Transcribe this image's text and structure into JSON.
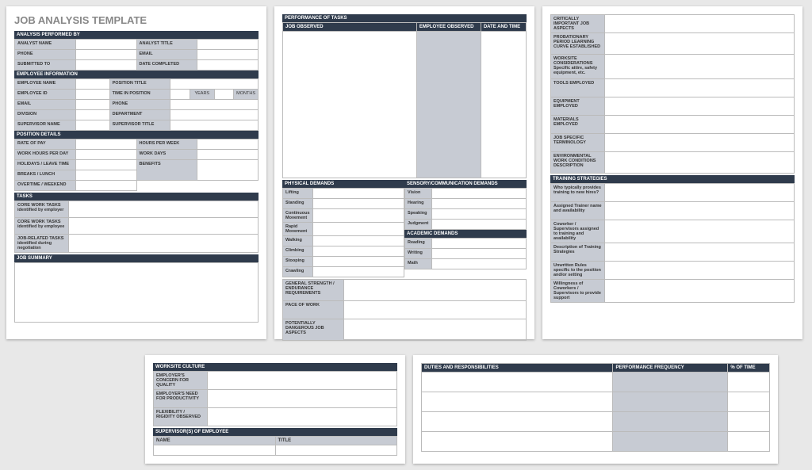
{
  "title": "JOB ANALYSIS TEMPLATE",
  "sections": {
    "analysis_performed_by": "ANALYSIS PERFORMED BY",
    "employee_information": "EMPLOYEE INFORMATION",
    "position_details": "POSITION DETAILS",
    "tasks": "TASKS",
    "job_summary": "JOB SUMMARY",
    "performance_of_tasks": "PERFORMANCE OF TASKS",
    "physical_demands": "PHYSICAL DEMANDS",
    "sensory_communication_demands": "SENSORY/COMMUNICATION DEMANDS",
    "academic_demands": "ACADEMIC DEMANDS",
    "training_strategies": "TRAINING STRATEGIES",
    "worksite_culture": "WORKSITE CULTURE",
    "supervisors_of_employee": "SUPERVISOR(S) OF EMPLOYEE",
    "duties_and_responsibilities": "DUTIES AND RESPONSIBILITIES"
  },
  "fields": {
    "analyst_name": "ANALYST NAME",
    "analyst_title": "ANALYST TITLE",
    "phone": "PHONE",
    "email": "EMAIL",
    "submitted_to": "SUBMITTED TO",
    "date_completed": "DATE COMPLETED",
    "employee_name": "EMPLOYEE NAME",
    "position_title": "POSITION TITLE",
    "employee_id": "EMPLOYEE ID",
    "time_in_position": "TIME IN POSITION",
    "years": "YEARS",
    "months": "MONTHS",
    "division": "DIVISION",
    "department": "DEPARTMENT",
    "supervisor_name": "SUPERVISOR NAME",
    "supervisor_title": "SUPERVISOR TITLE",
    "rate_of_pay": "RATE OF PAY",
    "hours_per_week": "HOURS PER WEEK",
    "work_hours_per_day": "WORK HOURS PER DAY",
    "work_days": "WORK DAYS",
    "holidays_leave_time": "HOLIDAYS / LEAVE TIME",
    "breaks_lunch": "BREAKS / LUNCH",
    "benefits": "BENEFITS",
    "overtime_weekend": "OVERTIME / WEEKEND",
    "core_work_tasks_employer": "CORE WORK TASKS identified by employer",
    "core_work_tasks_employee": "CORE WORK TASKS identified by employee",
    "job_related_tasks_neg": "JOB-RELATED TASKS identified during negotiation",
    "job_observed": "JOB OBSERVED",
    "employee_observed": "EMPLOYEE OBSERVED",
    "date_and_time": "DATE AND TIME",
    "lifting": "Lifting",
    "standing": "Standing",
    "continuous_movement": "Continuous Movement",
    "rapid_movement": "Rapid Movement",
    "walking": "Walking",
    "climbing": "Climbing",
    "stooping": "Stooping",
    "crawling": "Crawling",
    "vision": "Vision",
    "hearing": "Hearing",
    "speaking": "Speaking",
    "judgment": "Judgment",
    "reading": "Reading",
    "writing": "Writing",
    "math": "Math",
    "general_strength": "GENERAL STRENGTH / ENDURANCE REQUIREMENTS",
    "pace_of_work": "PACE OF WORK",
    "potentially_dangerous": "POTENTIALLY DANGEROUS JOB ASPECTS",
    "critically_important": "CRITICALLY IMPORTANT JOB ASPECTS",
    "probationary_period": "PROBATIONARY PERIOD LEARNING CURVE ESTABLISHED",
    "worksite_considerations": "WORKSITE CONSIDERATIONS Specific attire, safety equipment, etc.",
    "tools_employed": "TOOLS EMPLOYED",
    "equipment_employed": "EQUIPMENT EMPLOYED",
    "materials_employed": "MATERIALS EMPLOYED",
    "job_specific_terminology": "JOB SPECIFIC TERMINOLOGY",
    "environmental_work": "ENVIRONMENTAL WORK CONDITIONS DESCRIPTION",
    "who_typically_provides": "Who typically provides training to new hires?",
    "assigned_trainer": "Assigned Trainer name and availability",
    "coworker_supervisors": "Coworker / Supervisors assigned to training and availability",
    "description_training": "Description of Training Strategies",
    "unwritten_rules": "Unwritten Rules specific to the position and/or setting",
    "willingness_coworkers": "Willingness of Coworkers / Supervisors to provide support",
    "employer_concern_quality": "EMPLOYER'S CONCERN FOR QUALITY",
    "employer_need_productivity": "EMPLOYER'S NEED FOR PRODUCTIVITY",
    "flexibility_rigidity": "FLEXIBILITY / RIGIDITY OBSERVED",
    "name": "NAME",
    "sup_title": "TITLE",
    "performance_frequency": "PERFORMANCE FREQUENCY",
    "pct_of_time": "% OF TIME"
  }
}
